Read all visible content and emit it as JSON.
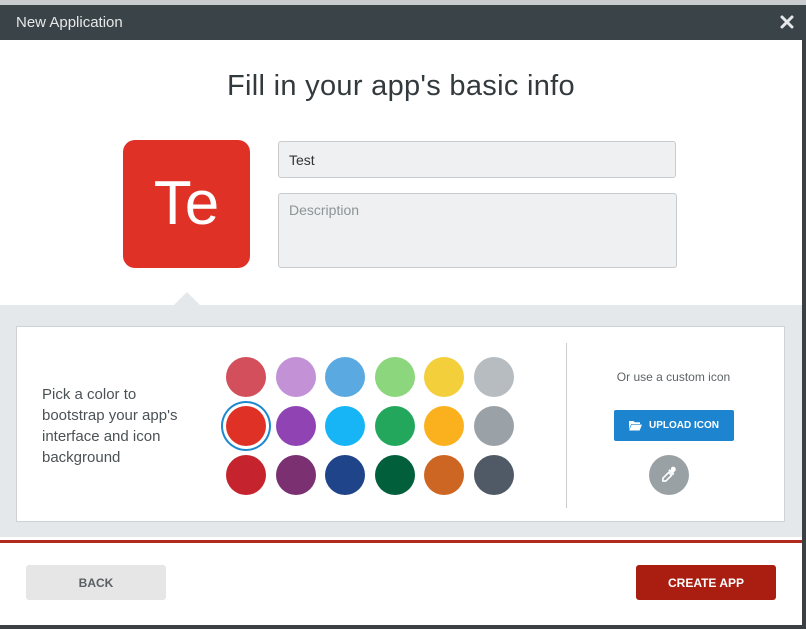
{
  "window": {
    "title": "New Application"
  },
  "heading": "Fill in your app's basic info",
  "app": {
    "initials": "Te",
    "color": "#e03127",
    "name_value": "Test",
    "description_placeholder": "Description"
  },
  "color_picker": {
    "prompt": "Pick a color to bootstrap your app's interface and icon background",
    "selected": "#e03127",
    "rows": [
      [
        "#d24f5b",
        "#c391d6",
        "#5aaae1",
        "#8cd67d",
        "#f4cf3c",
        "#b7bcc0"
      ],
      [
        "#e03127",
        "#9044b4",
        "#17b5f6",
        "#23a75c",
        "#fbb11d",
        "#9aa1a7"
      ],
      [
        "#c5232d",
        "#7a3071",
        "#1f4489",
        "#015f3c",
        "#cd6623",
        "#4f5a66"
      ]
    ]
  },
  "custom_icon": {
    "label": "Or use a custom icon",
    "upload_label": "UPLOAD ICON"
  },
  "footer": {
    "back_label": "BACK",
    "create_label": "CREATE APP",
    "accent": "#a91e10"
  }
}
